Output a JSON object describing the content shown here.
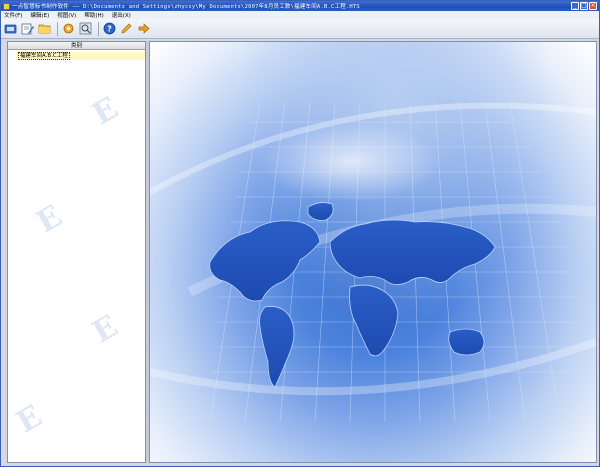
{
  "window": {
    "title": "一点智慧标书制作软件 —— D:\\Documents and Settings\\zhycsy\\My Documents\\2007年8月员工数\\福建车间A.B.C工程.HTS",
    "controls": {
      "minimize": "_",
      "maximize": "□",
      "close": "×"
    }
  },
  "menu": [
    "文件(F)",
    "编辑(E)",
    "视图(V)",
    "帮助(H)",
    "退出(X)"
  ],
  "toolbar": {
    "buttons": [
      "home-icon",
      "edit-icon",
      "folder-icon",
      "settings-gear-icon",
      "preview-icon",
      "help-icon",
      "edit-pencil-icon",
      "exit-arrow-icon"
    ]
  },
  "left_panel": {
    "header": "类别",
    "items": [
      "福建车间A.B.C工程"
    ]
  },
  "colors": {
    "title_bar": "#1f4fb5",
    "selection": "#fff7c4",
    "accent": "#3a71d0"
  }
}
